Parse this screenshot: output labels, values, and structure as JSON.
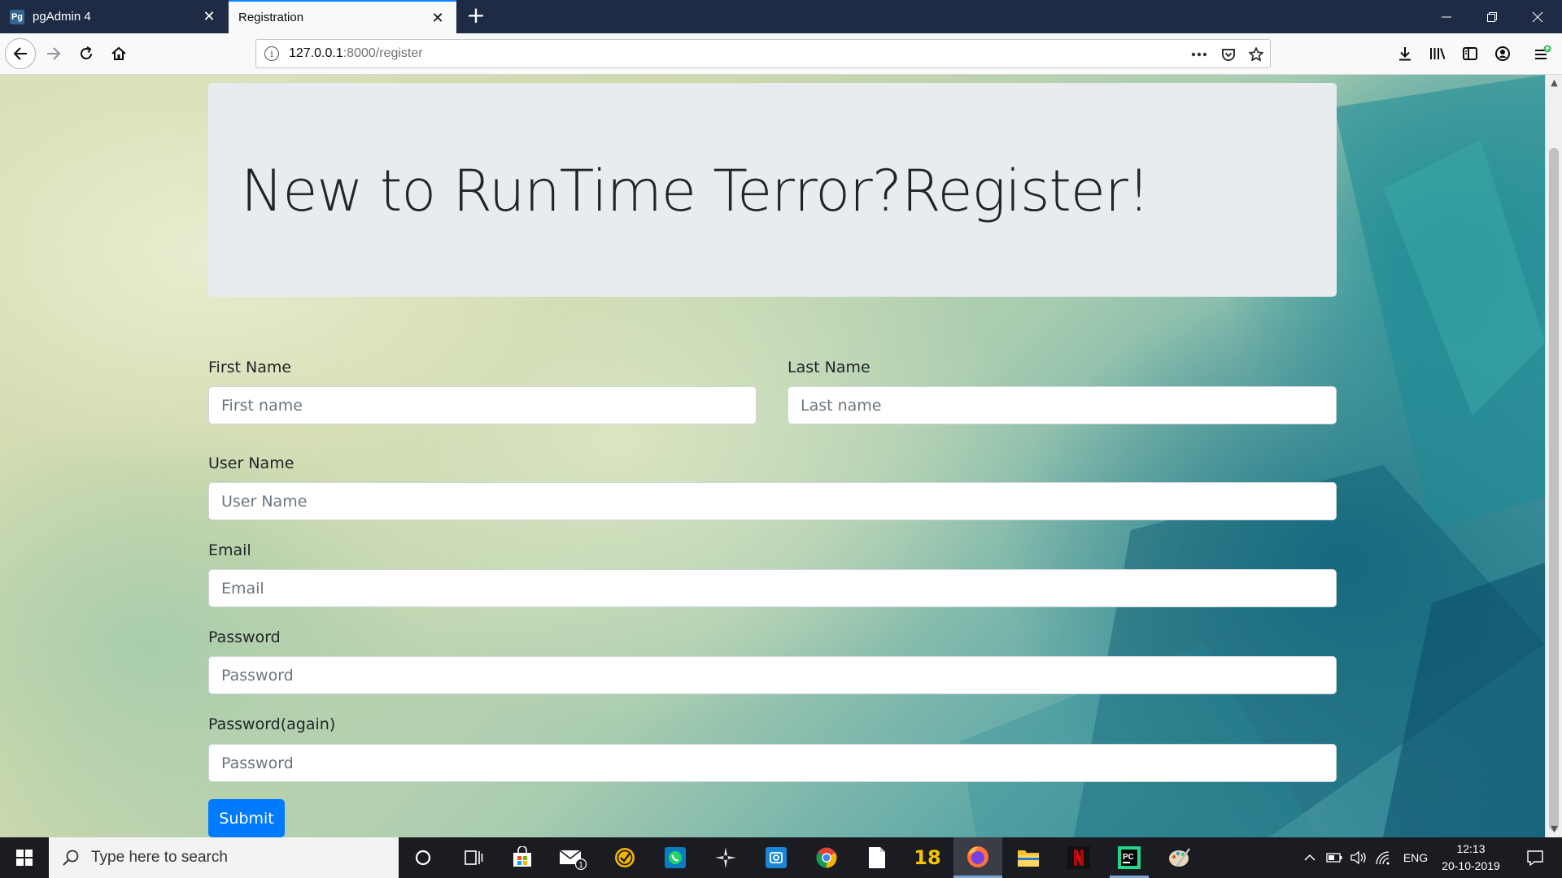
{
  "browser": {
    "tabs": [
      {
        "label": "pgAdmin 4",
        "favicon_text": "Pg",
        "active": false
      },
      {
        "label": "Registration",
        "active": true
      }
    ],
    "url_host": "127.0.0.1",
    "url_path": ":8000/register"
  },
  "page": {
    "heading": "New to RunTime Terror?Register!",
    "form": {
      "first_name_label": "First Name",
      "first_name_placeholder": "First name",
      "last_name_label": "Last Name",
      "last_name_placeholder": "Last name",
      "username_label": "User Name",
      "username_placeholder": "User Name",
      "email_label": "Email",
      "email_placeholder": "Email",
      "password_label": "Password",
      "password_placeholder": "Password",
      "password_again_label": "Password(again)",
      "password_again_placeholder": "Password",
      "submit_label": "Submit"
    }
  },
  "colors": {
    "primary": "#007bff",
    "jumbotron": "#e9ecef",
    "tabstrip": "#1f2a44",
    "taskbar": "#1a1c22"
  },
  "taskbar": {
    "search_placeholder": "Type here to search",
    "mail_badge": "1",
    "calendar_text": "18",
    "language": "ENG",
    "time": "12:13",
    "date": "20-10-2019"
  }
}
